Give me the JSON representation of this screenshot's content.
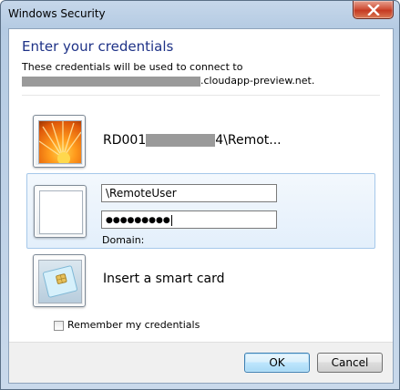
{
  "window": {
    "title": "Windows Security"
  },
  "header": {
    "heading": "Enter your credentials",
    "description_line1": "These credentials will be used to connect to",
    "description_host_suffix": ".cloudapp-preview.net."
  },
  "tiles": {
    "saved_user": {
      "label_prefix": "RD001",
      "label_suffix": "4\\Remot..."
    },
    "credential_entry": {
      "username_value": "\\RemoteUser",
      "password_mask": "●●●●●●●●●",
      "domain_label": "Domain:"
    },
    "smart_card": {
      "label": "Insert a smart card"
    }
  },
  "remember": {
    "label": "Remember my credentials",
    "checked": false
  },
  "buttons": {
    "ok_label": "OK",
    "cancel_label": "Cancel"
  },
  "colors": {
    "heading": "#1e3287",
    "selection_border": "#a6c8ea",
    "close_button": "#c53a22"
  }
}
